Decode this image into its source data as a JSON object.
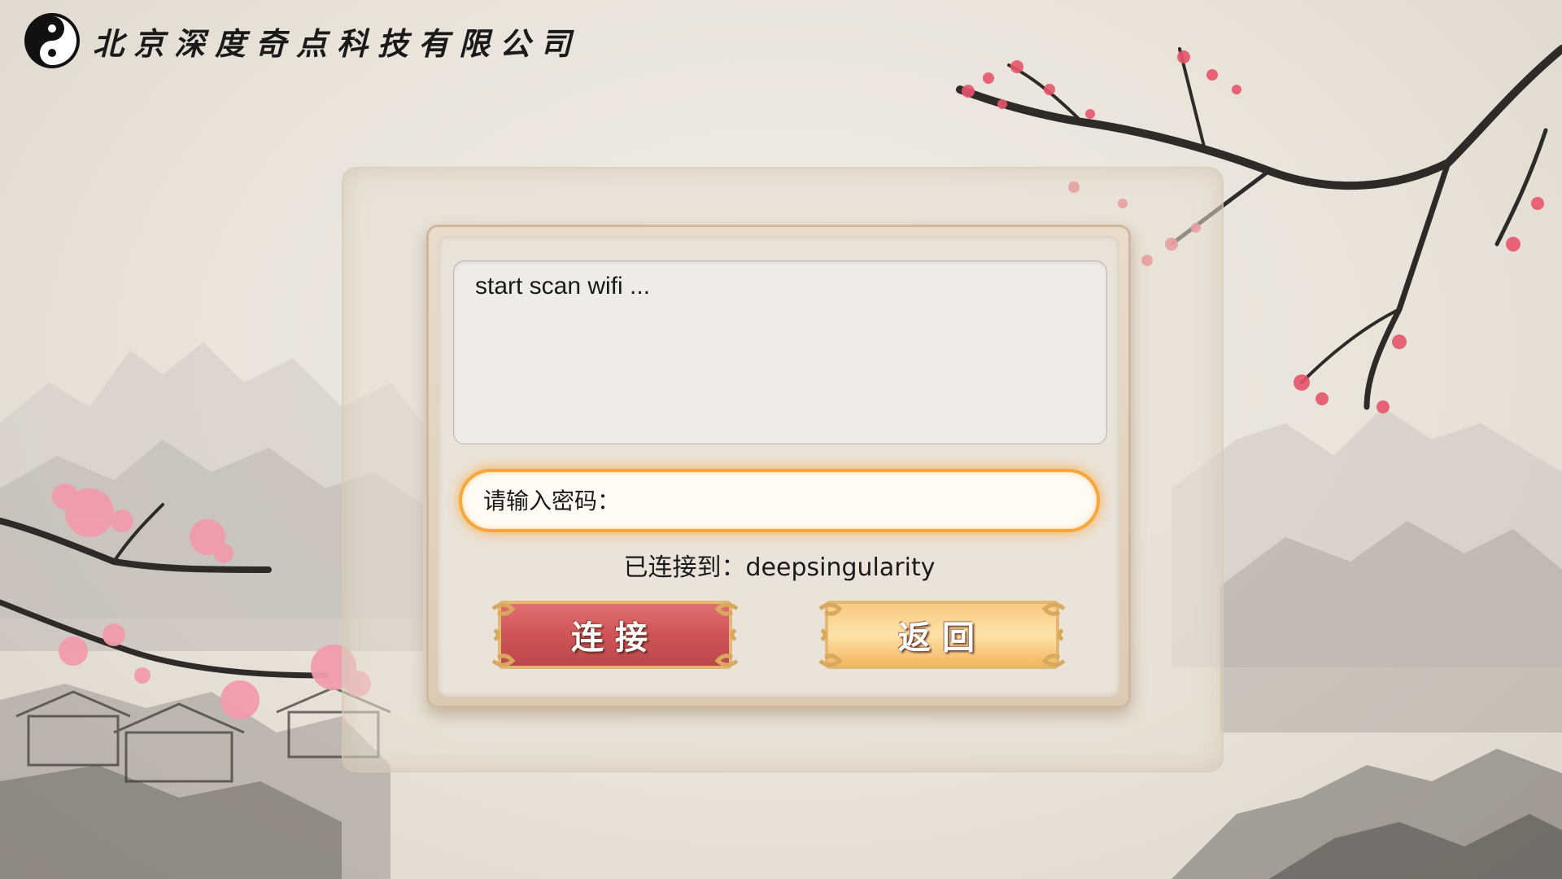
{
  "header": {
    "company_name": "北京深度奇点科技有限公司",
    "logo_icon": "yin-yang-icon"
  },
  "log": {
    "text": "start scan wifi ..."
  },
  "password": {
    "placeholder": "请输入密码：",
    "value": ""
  },
  "status": {
    "text": "已连接到：deepsingularity"
  },
  "buttons": {
    "connect_label": "连接",
    "back_label": "返回"
  },
  "colors": {
    "connect_button": "#cf5456",
    "back_button": "#f7bf6a",
    "input_glow": "#f7a738",
    "plum_blossom": "#e8556c"
  }
}
